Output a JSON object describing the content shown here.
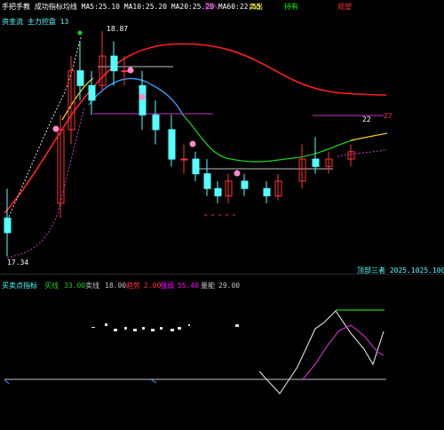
{
  "top_bar": {
    "indicator_line": "手把手教 成功指标均线 MA5:25.10 MA10:25.20 MA20:25.20 MA60:22.55",
    "signal_1": "买入",
    "signal_2": "卖出",
    "signal_3": "持有",
    "signal_4": "观望"
  },
  "price_panel": {
    "mode_label": "资金流 主力控盘 13",
    "high_label": "18.87",
    "low_label": "17.34",
    "right_label_a": "22",
    "right_label_b": "27"
  },
  "indicator_panel": {
    "title": "买卖点指标",
    "v1_label": "买线",
    "v1": "33.00",
    "v2_label": "卖线",
    "v2": "18.00",
    "v3_label": "趋势",
    "v3": "2.00",
    "v4_label": "强弱",
    "v4": "55.40",
    "v5_label": "量能",
    "v5": "29.00",
    "right_label": "顶部三者 2025.1025.100"
  },
  "colors": {
    "bg": "#000000",
    "up": "#ff3232",
    "down": "#54ffff",
    "ma_red": "#ff2020",
    "ma_blue": "#3aa0ff",
    "ma_green": "#22cc22",
    "ma_yellow": "#f0d020",
    "ma_magenta": "#cc33cc",
    "support": "#c0c0c0",
    "cursor": "#ff00ff"
  },
  "chart_data": {
    "type": "candlestick",
    "candles": [
      {
        "o": 17.6,
        "h": 17.8,
        "l": 17.34,
        "c": 17.5
      },
      {
        "o": 17.7,
        "h": 18.3,
        "l": 17.6,
        "c": 18.2
      },
      {
        "o": 18.2,
        "h": 18.7,
        "l": 18.1,
        "c": 18.6
      },
      {
        "o": 18.6,
        "h": 18.8,
        "l": 18.4,
        "c": 18.5
      },
      {
        "o": 18.5,
        "h": 18.6,
        "l": 18.3,
        "c": 18.4
      },
      {
        "o": 18.5,
        "h": 18.87,
        "l": 18.45,
        "c": 18.7
      },
      {
        "o": 18.7,
        "h": 18.8,
        "l": 18.5,
        "c": 18.6
      },
      {
        "o": 18.6,
        "h": 18.7,
        "l": 18.5,
        "c": 18.6
      },
      {
        "o": 18.5,
        "h": 18.6,
        "l": 18.2,
        "c": 18.3
      },
      {
        "o": 18.3,
        "h": 18.4,
        "l": 18.1,
        "c": 18.2
      },
      {
        "o": 18.2,
        "h": 18.3,
        "l": 17.95,
        "c": 18.0
      },
      {
        "o": 18.0,
        "h": 18.1,
        "l": 17.9,
        "c": 18.0
      },
      {
        "o": 18.0,
        "h": 18.05,
        "l": 17.85,
        "c": 17.9
      },
      {
        "o": 17.9,
        "h": 18.0,
        "l": 17.75,
        "c": 17.8
      },
      {
        "o": 17.8,
        "h": 17.85,
        "l": 17.7,
        "c": 17.75
      },
      {
        "o": 17.75,
        "h": 17.9,
        "l": 17.7,
        "c": 17.85
      },
      {
        "o": 17.85,
        "h": 17.9,
        "l": 17.75,
        "c": 17.8
      },
      {
        "o": 17.8,
        "h": 17.85,
        "l": 17.7,
        "c": 17.75
      },
      {
        "o": 17.75,
        "h": 17.9,
        "l": 17.72,
        "c": 17.85
      },
      {
        "o": 17.85,
        "h": 18.1,
        "l": 17.8,
        "c": 18.0
      },
      {
        "o": 18.0,
        "h": 18.15,
        "l": 17.9,
        "c": 17.95
      },
      {
        "o": 17.95,
        "h": 18.05,
        "l": 17.9,
        "c": 18.0
      },
      {
        "o": 18.0,
        "h": 18.1,
        "l": 17.95,
        "c": 18.05
      }
    ]
  }
}
